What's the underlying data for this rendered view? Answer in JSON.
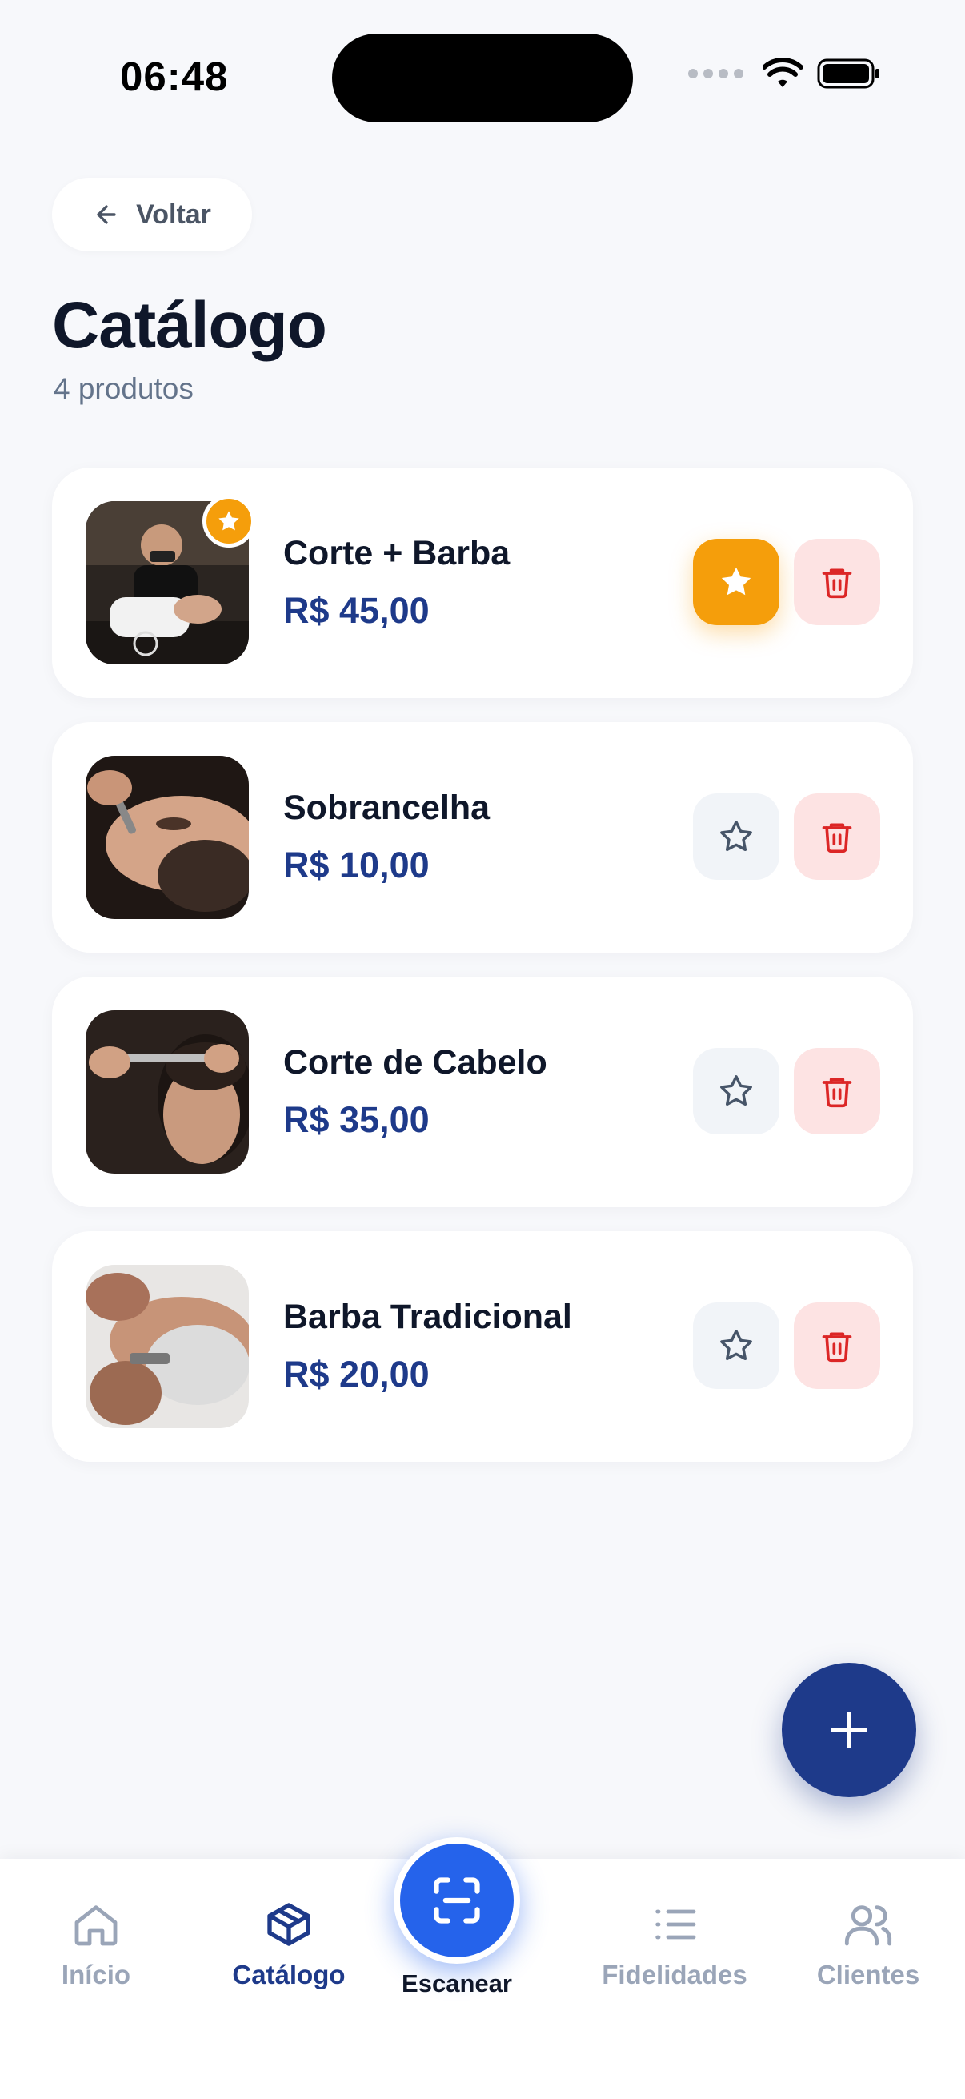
{
  "status_bar": {
    "time": "06:48"
  },
  "header": {
    "back_label": "Voltar",
    "title": "Catálogo",
    "subtitle": "4 produtos"
  },
  "products": [
    {
      "name": "Corte + Barba",
      "price": "R$ 45,00",
      "featured": true
    },
    {
      "name": "Sobrancelha",
      "price": "R$ 10,00",
      "featured": false
    },
    {
      "name": "Corte de Cabelo",
      "price": "R$ 35,00",
      "featured": false
    },
    {
      "name": "Barba Tradicional",
      "price": "R$ 20,00",
      "featured": false
    }
  ],
  "nav": {
    "inicio": "Início",
    "catalogo": "Catálogo",
    "escanear": "Escanear",
    "fidelidades": "Fidelidades",
    "clientes": "Clientes",
    "active": "catalogo"
  },
  "colors": {
    "primary": "#1e3a8a",
    "accent_blue": "#2563eb",
    "featured": "#f59e0b",
    "danger": "#dc2626",
    "danger_bg": "#fde3e3"
  },
  "icons": {
    "back": "arrow-left-icon",
    "favorite": "star-icon",
    "delete": "trash-icon",
    "add": "plus-icon",
    "home": "home-icon",
    "catalog": "box-icon",
    "scan": "scan-icon",
    "loyalty": "list-icon",
    "clients": "users-icon"
  }
}
